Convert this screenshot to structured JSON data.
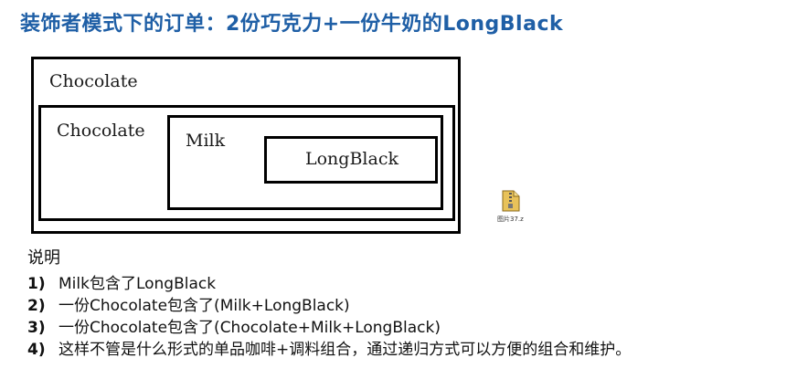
{
  "title": "装饰者模式下的订单：2份巧克力+一份牛奶的LongBlack",
  "diagram": {
    "outer_label": "Chocolate",
    "mid_label": "Chocolate",
    "milk_label": "Milk",
    "core_label": "LongBlack"
  },
  "file": {
    "icon": "zip-file-icon",
    "caption": "图片37.z"
  },
  "notes": {
    "heading": "说明",
    "items": [
      {
        "num": "1)",
        "text": "Milk包含了LongBlack"
      },
      {
        "num": "2)",
        "text": "一份Chocolate包含了(Milk+LongBlack)"
      },
      {
        "num": "3)",
        "text": "一份Chocolate包含了(Chocolate+Milk+LongBlack)"
      },
      {
        "num": "4)",
        "text": "这样不管是什么形式的单品咖啡+调料组合，通过递归方式可以方便的组合和维护。"
      }
    ]
  },
  "colors": {
    "title": "#1f5fa6",
    "border": "#000000"
  }
}
